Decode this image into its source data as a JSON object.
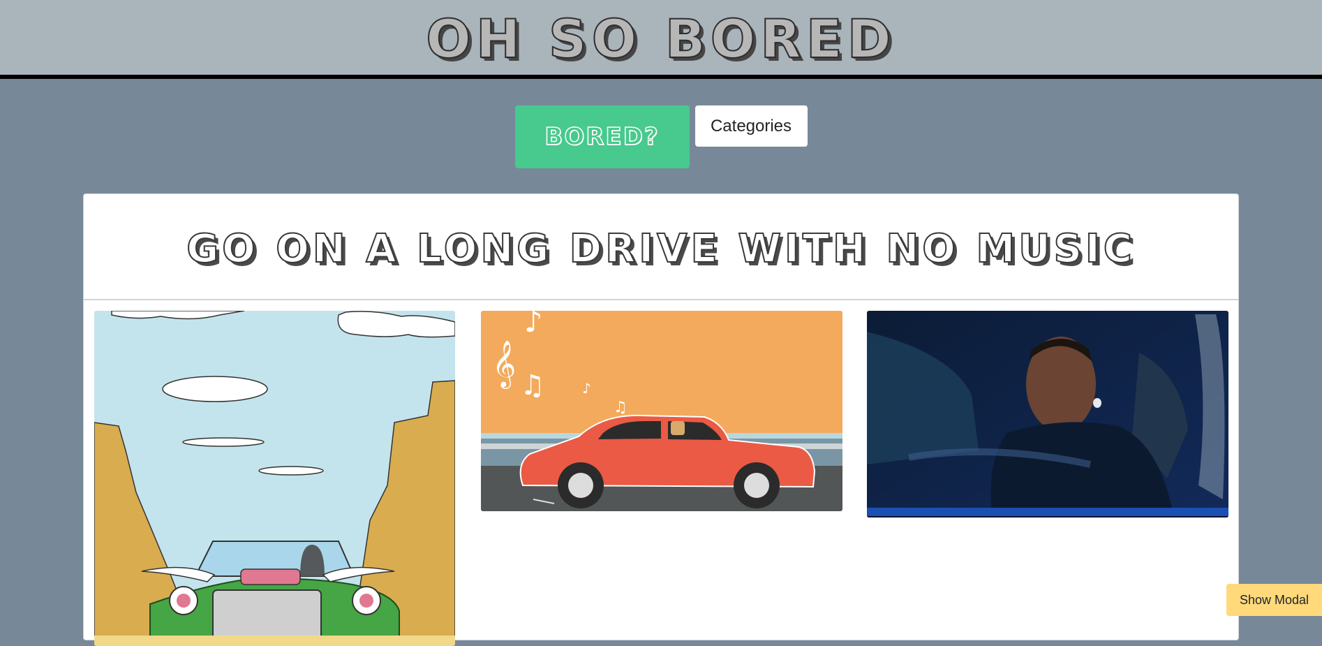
{
  "header": {
    "title": "OH SO BORED"
  },
  "actions": {
    "bored_label": "BORED?",
    "categories_label": "Categories"
  },
  "activity": {
    "title": "GO ON A LONG DRIVE WITH NO MUSIC"
  },
  "gifs": [
    {
      "name": "cartoon-desert-car-gif"
    },
    {
      "name": "red-car-music-notes-gif"
    },
    {
      "name": "man-driving-car-gif"
    }
  ],
  "modal": {
    "show_label": "Show Modal"
  },
  "colors": {
    "header_bg": "#aab4bb",
    "page_bg": "#778899",
    "bored_button": "#48c98d",
    "modal_button": "#ffd97a"
  }
}
